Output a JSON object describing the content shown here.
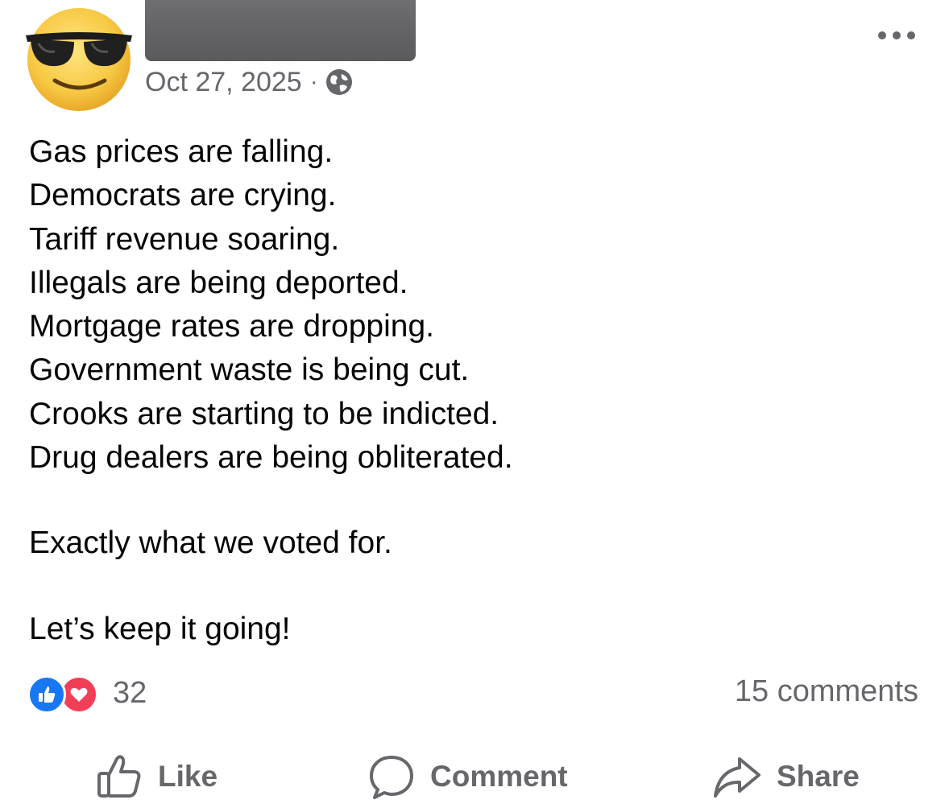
{
  "post": {
    "avatar_icon": "sunglasses-emoji-avatar",
    "date": "Oct 27, 2025",
    "separator": "·",
    "privacy_icon": "globe-icon",
    "more_icon": "more-horizontal-icon",
    "lines": [
      "Gas prices are falling.",
      "Democrats are crying.",
      "Tariff revenue soaring.",
      "Illegals are being deported.",
      "Mortgage rates are dropping.",
      "Government waste is being cut.",
      "Crooks are starting to be indicted.",
      "Drug dealers are being obliterated."
    ],
    "closing_1": "Exactly what we voted for.",
    "closing_2": "Let’s keep it going!"
  },
  "engagement": {
    "reaction_icons": [
      "like-reaction-icon",
      "love-reaction-icon"
    ],
    "reaction_count": "32",
    "comments": "15 comments"
  },
  "actions": {
    "like_label": "Like",
    "comment_label": "Comment",
    "share_label": "Share"
  },
  "colors": {
    "text": "#050505",
    "secondary": "#65676b",
    "like_blue": "#1877f2",
    "love_red": "#f33e58"
  }
}
